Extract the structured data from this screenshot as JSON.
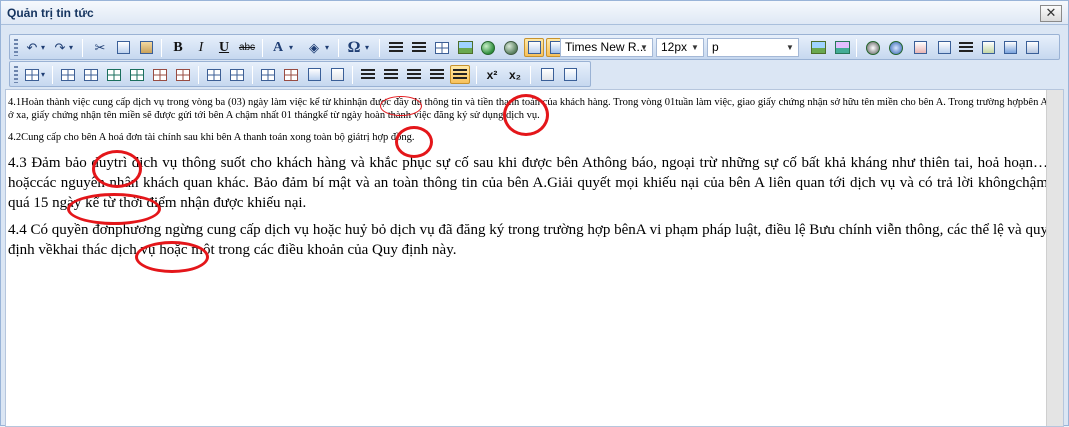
{
  "window": {
    "title": "Quản trị tin tức",
    "close_glyph": "✕"
  },
  "toolbar": {
    "undo_icon": "↶",
    "redo_icon": "↷",
    "cut_icon": "✂",
    "bold_label": "B",
    "italic_label": "I",
    "underline_label": "U",
    "strike_label": "abc",
    "forecolor_label": "A",
    "special_char_label": "Ω",
    "font_name": "Times New R...",
    "font_size": "12px",
    "paragraph_style": "p",
    "superscript_label": "x²",
    "subscript_label": "x₂"
  },
  "editor": {
    "paragraphs": [
      "4.1Hoàn thành việc cung cấp dịch vụ trong vòng ba (03) ngày làm việc kể từ khinhận được đầy đủ thông tin và tiền thanh toán của khách hàng. Trong vòng 01tuần làm việc, giao giấy chứng nhận sở hữu tên miền cho bên A. Trong trường hợpbên A ở xa, giấy chứng nhận tên miền sẽ được gửi tới bên A chậm nhất 01 thángkể từ ngày hoàn thành việc đăng ký sử dụng dịch vụ.",
      "4.2Cung cấp cho bên A hoá đơn tài chính sau khi bên A thanh toán xong toàn bộ giátrị hợp đồng.",
      "4.3 Đảm bảo duytrì dịch vụ thông suốt cho khách hàng và khắc phục sự cố sau khi được bên Athông báo, ngoại trừ những sự cố bất khả kháng như thiên tai, hoả hoạn… hoặccác nguyên nhân khách quan khác. Bảo đảm bí mật và an toàn thông tin của bên A.Giải quyết mọi khiếu nại của bên A liên quan tới dịch vụ và có trả lời khôngchậm quá 15 ngày kể từ thời điểm nhận được khiếu nại.",
      "4.4 Có quyền đơnphương ngừng cung cấp dịch vụ hoặc huỷ bỏ dịch vụ đã đăng ký trong trường hợp bênA vi phạm pháp luật, điều lệ Bưu chính viễn thông, các thể lệ và quy định vềkhai thác dịch vụ hoặc một trong các điều khoản của Quy định này."
    ]
  }
}
